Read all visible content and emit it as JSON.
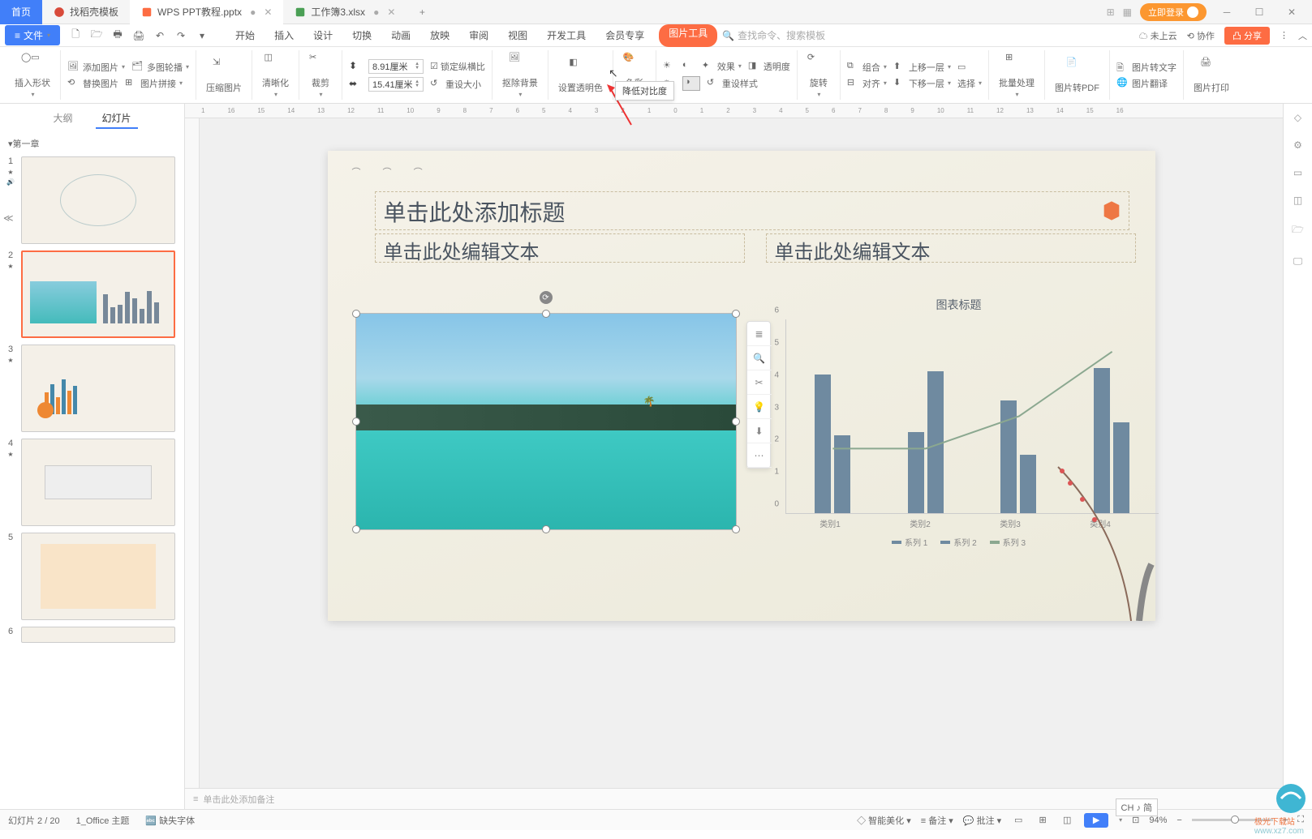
{
  "title_bar": {
    "home": "首页",
    "tabs": [
      {
        "icon": "doc",
        "label": "找稻壳模板"
      },
      {
        "icon": "ppt",
        "label": "WPS PPT教程.pptx",
        "active": true
      },
      {
        "icon": "xls",
        "label": "工作簿3.xlsx"
      }
    ],
    "login": "立即登录"
  },
  "menu": {
    "file": "文件",
    "tabs": [
      "开始",
      "插入",
      "设计",
      "切换",
      "动画",
      "放映",
      "审阅",
      "视图",
      "开发工具",
      "会员专享"
    ],
    "context_tab": "图片工具",
    "search_placeholder": "查找命令、搜索模板",
    "cloud": "未上云",
    "collab": "协作",
    "share": "分享"
  },
  "ribbon": {
    "insert_shape": "插入形状",
    "add_image": "添加图片",
    "multi_outline": "多图轮播",
    "replace_image": "替换图片",
    "image_merge": "图片拼接",
    "compress": "压缩图片",
    "sharpen": "清晰化",
    "crop": "裁剪",
    "height_val": "8.91厘米",
    "width_val": "15.41厘米",
    "lock_ratio": "锁定纵横比",
    "reset_size": "重设大小",
    "remove_bg": "抠除背景",
    "set_transparent": "设置透明色",
    "color": "色彩",
    "effects": "效果",
    "transparency": "透明度",
    "reset_style": "重设样式",
    "rotate": "旋转",
    "group": "组合",
    "align": "对齐",
    "move_up": "上移一层",
    "move_down": "下移一层",
    "select": "选择",
    "batch": "批量处理",
    "to_pdf": "图片转PDF",
    "to_text": "图片转文字",
    "translate": "图片翻译",
    "print_img": "图片打印"
  },
  "tooltip": "降低对比度",
  "outline": {
    "tab_outline": "大纲",
    "tab_slides": "幻灯片",
    "section": "第一章"
  },
  "slide": {
    "title_placeholder": "单击此处添加标题",
    "text_placeholder": "单击此处编辑文本",
    "chart_title": "图表标题",
    "legend": [
      "系列 1",
      "系列 2",
      "系列 3"
    ],
    "x_categories": [
      "类别1",
      "类别2",
      "类别3",
      "类别4"
    ]
  },
  "chart_data": {
    "type": "bar",
    "title": "图表标题",
    "categories": [
      "类别1",
      "类别2",
      "类别3",
      "类别4"
    ],
    "series": [
      {
        "name": "系列 1",
        "values": [
          4.3,
          2.5,
          3.5,
          4.5
        ]
      },
      {
        "name": "系列 2",
        "values": [
          2.4,
          4.4,
          1.8,
          2.8
        ]
      },
      {
        "name": "系列 3",
        "values": [
          2.0,
          2.0,
          3.0,
          5.0
        ],
        "type": "line"
      }
    ],
    "y_ticks": [
      0,
      1,
      2,
      3,
      4,
      5,
      6
    ],
    "ylim": [
      0,
      6
    ]
  },
  "notes_placeholder": "单击此处添加备注",
  "status": {
    "slide_pos": "幻灯片 2 / 20",
    "theme": "1_Office 主题",
    "missing_font": "缺失字体",
    "beautify": "智能美化",
    "notes": "备注",
    "comment": "批注",
    "zoom": "94%",
    "ime": "CH ♪ 简"
  },
  "ruler_marks": [
    "1",
    "16",
    "15",
    "14",
    "13",
    "12",
    "11",
    "10",
    "9",
    "8",
    "7",
    "6",
    "5",
    "4",
    "3",
    "2",
    "1",
    "0",
    "1",
    "2",
    "3",
    "4",
    "5",
    "6",
    "7",
    "8",
    "9",
    "10",
    "11",
    "12",
    "13",
    "14",
    "15",
    "16"
  ],
  "watermark_url": "www.xz7.com",
  "watermark_text": "极光下载站"
}
